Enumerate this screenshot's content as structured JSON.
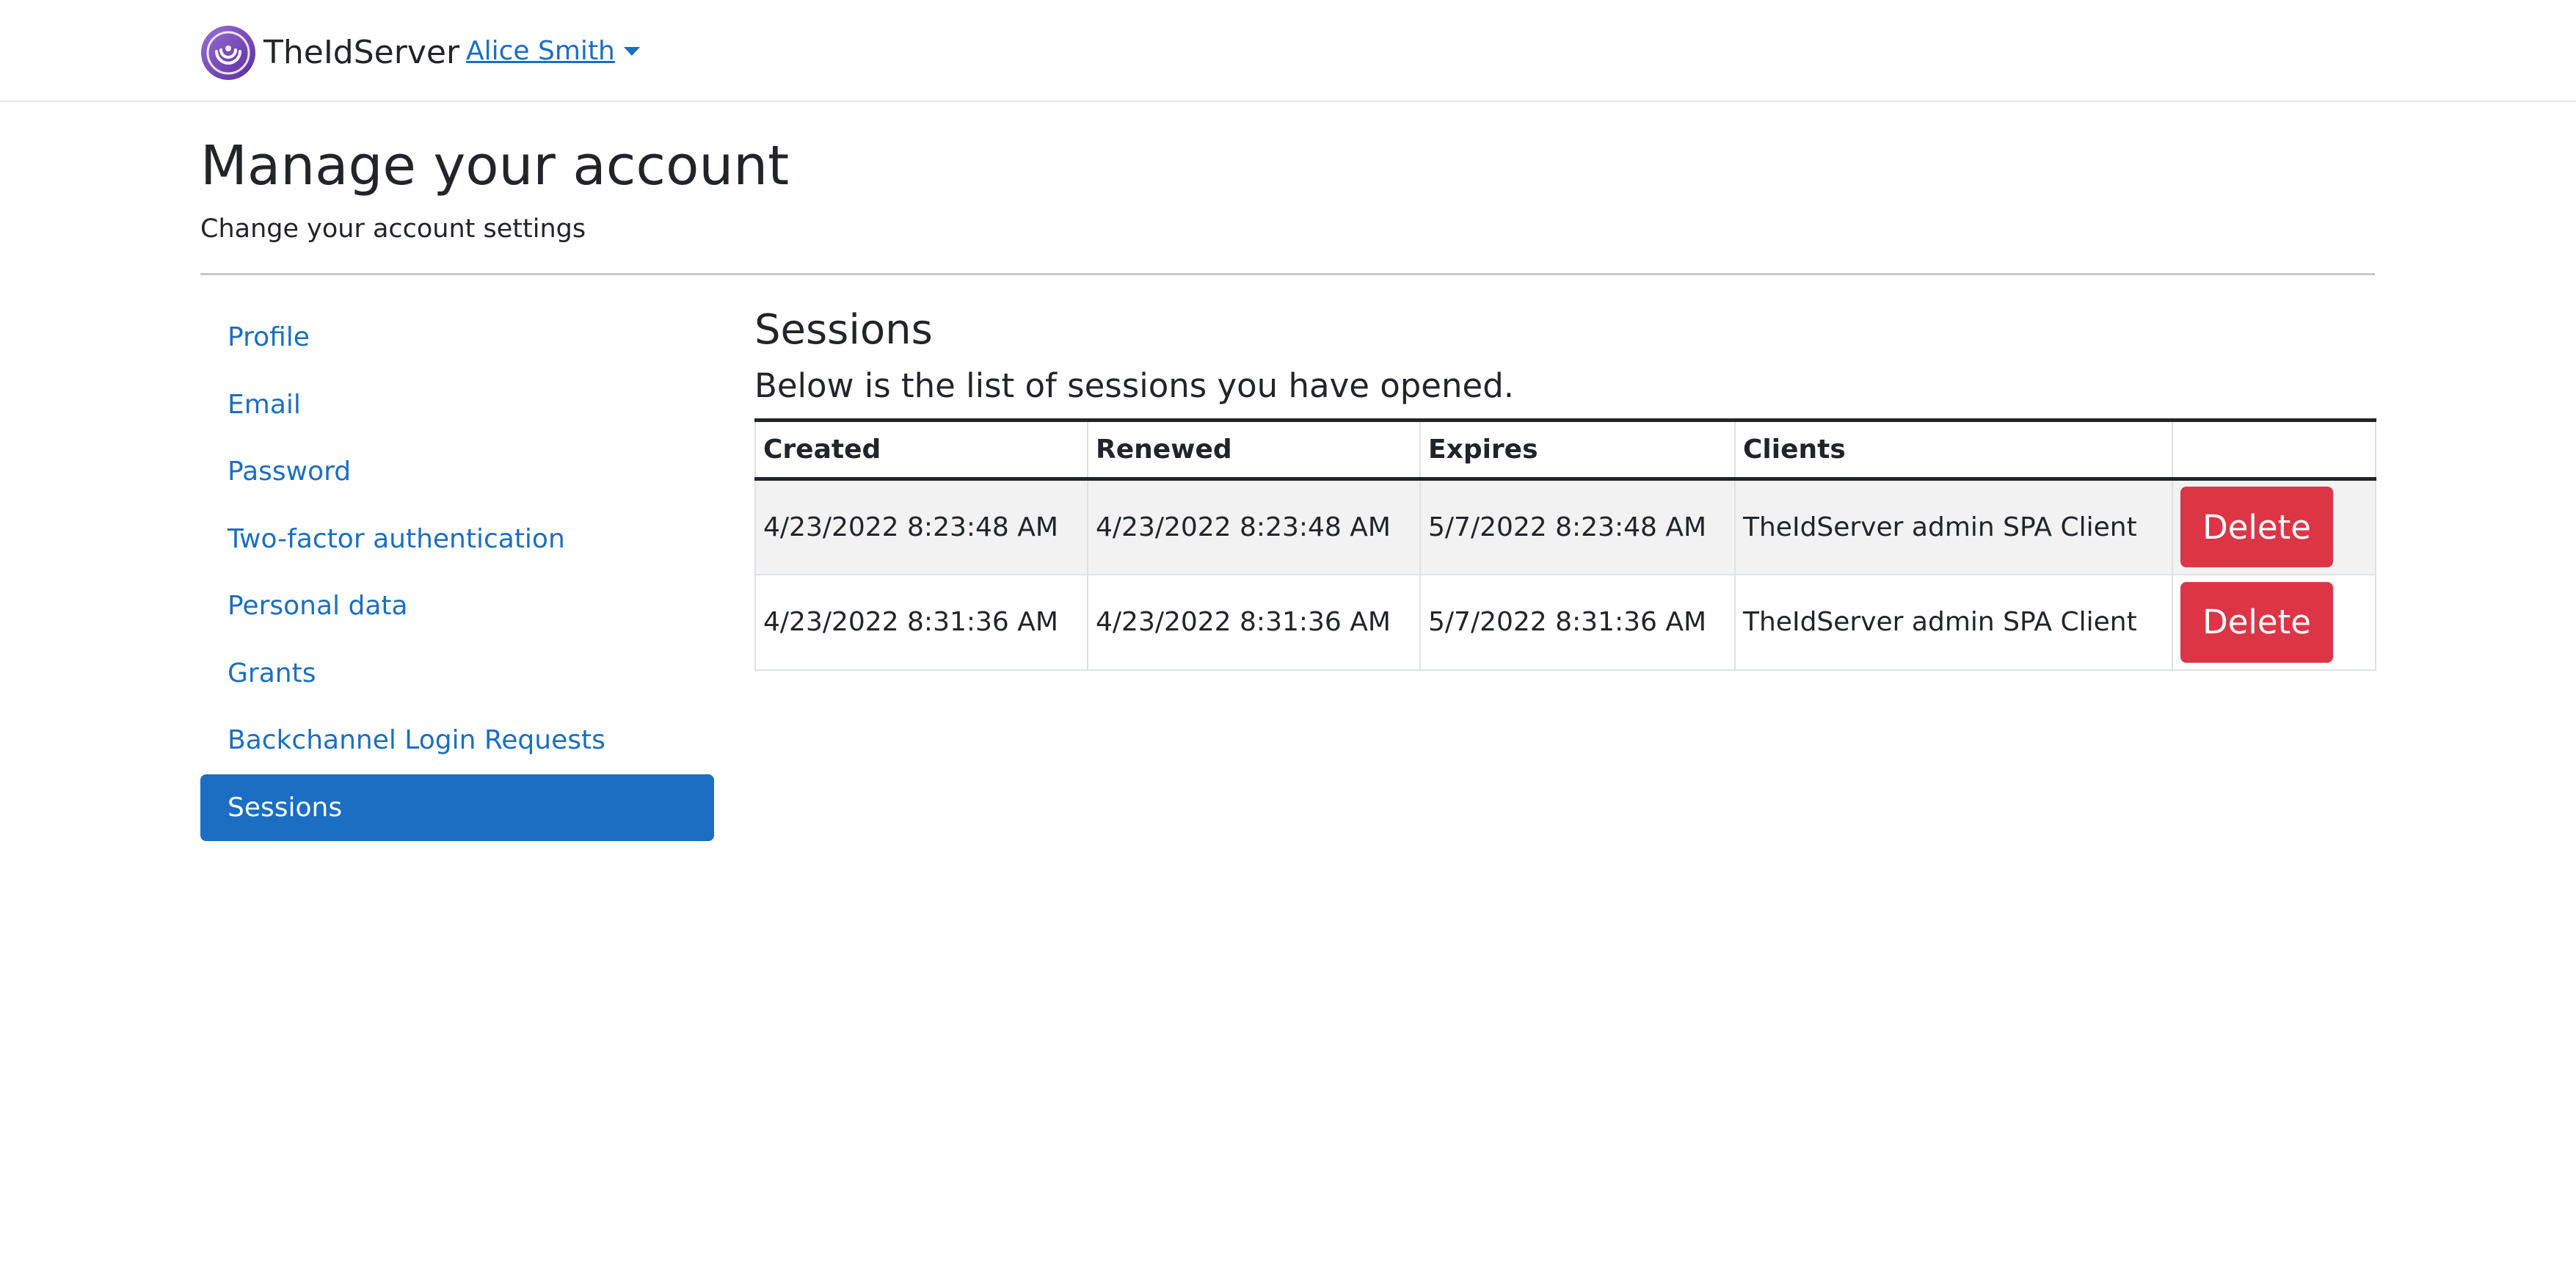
{
  "navbar": {
    "brand_name": "TheIdServer",
    "logo_icon": "theidserver-logo-icon",
    "user_menu_label": "Alice Smith",
    "accent_color": "#1b6ec2"
  },
  "header": {
    "title": "Manage your account",
    "subtitle": "Change your account settings"
  },
  "sidebar": {
    "items": [
      {
        "label": "Profile"
      },
      {
        "label": "Email"
      },
      {
        "label": "Password"
      },
      {
        "label": "Two-factor authentication"
      },
      {
        "label": "Personal data"
      },
      {
        "label": "Grants"
      },
      {
        "label": "Backchannel Login Requests"
      },
      {
        "label": "Sessions"
      }
    ],
    "active_item": "Sessions"
  },
  "main": {
    "section_title": "Sessions",
    "description": "Below is the list of sessions you have opened.",
    "table": {
      "columns": [
        "Created",
        "Renewed",
        "Expires",
        "Clients",
        ""
      ],
      "rows": [
        {
          "created": "4/23/2022 8:23:48 AM",
          "renewed": "4/23/2022 8:23:48 AM",
          "expires": "5/7/2022 8:23:48 AM",
          "clients": "TheIdServer admin SPA Client",
          "action_label": "Delete"
        },
        {
          "created": "4/23/2022 8:31:36 AM",
          "renewed": "4/23/2022 8:31:36 AM",
          "expires": "5/7/2022 8:31:36 AM",
          "clients": "TheIdServer admin SPA Client",
          "action_label": "Delete"
        }
      ]
    },
    "delete_button_color": "#dc3545"
  }
}
